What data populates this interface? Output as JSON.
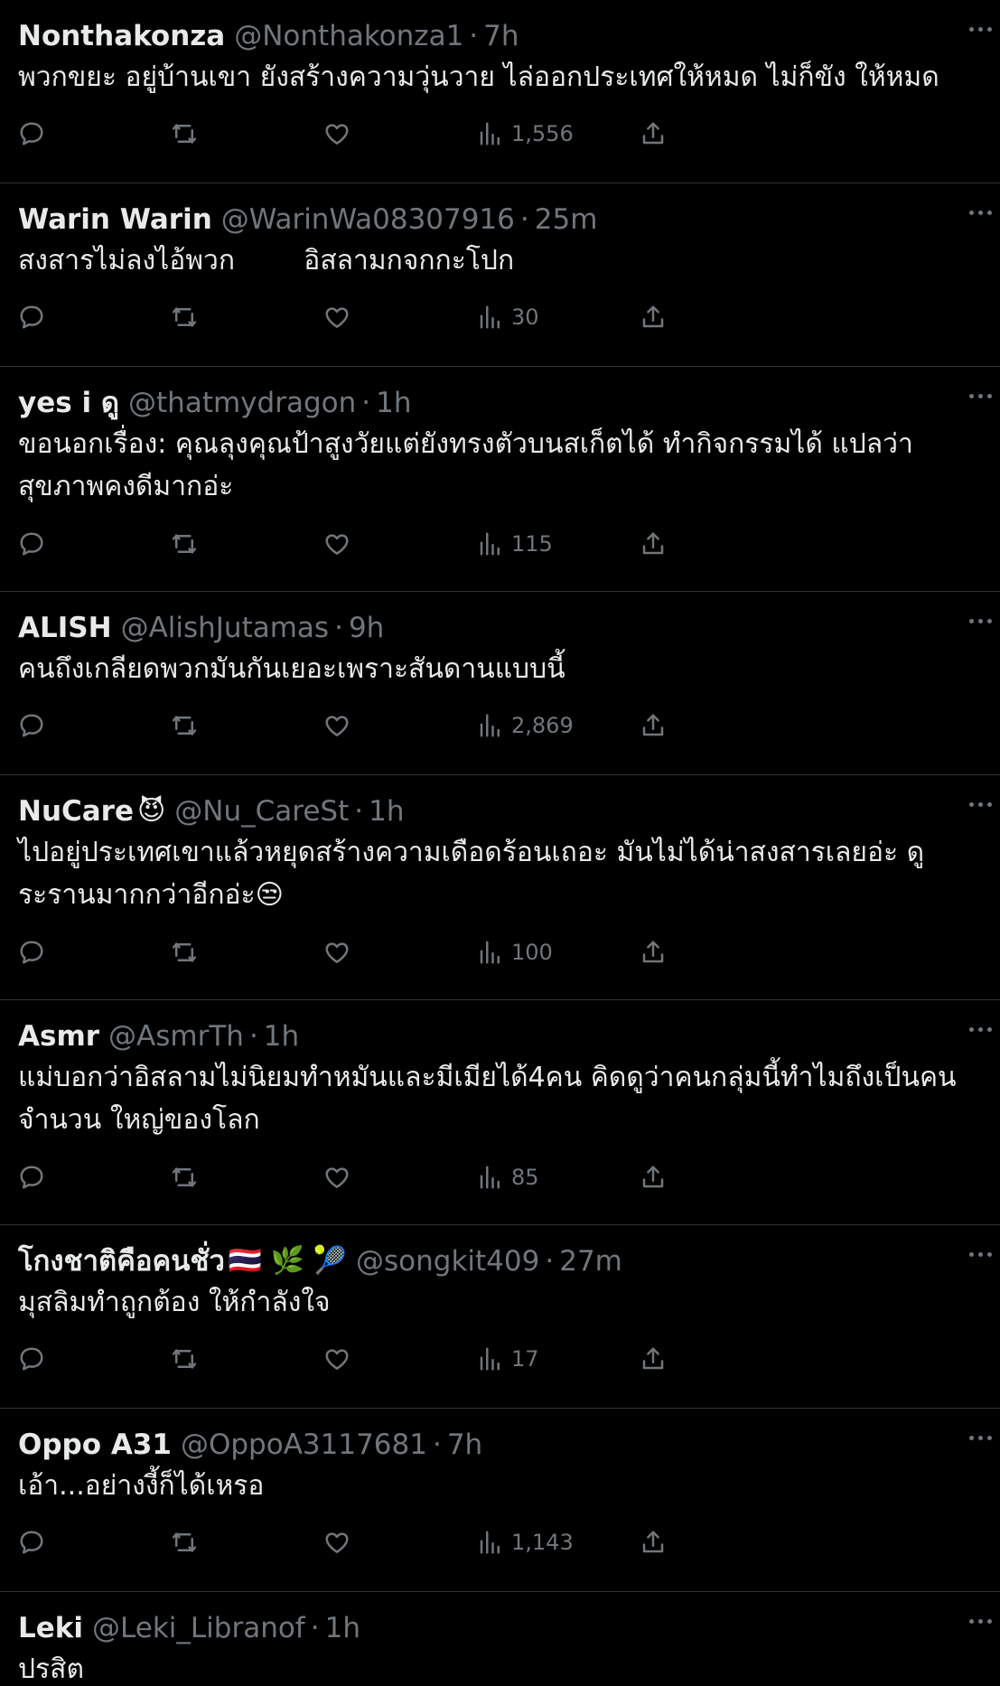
{
  "tweets": [
    {
      "name": "Nonthakonza",
      "emoji": "",
      "handle": "@Nonthakonza1",
      "time": "7h",
      "text": "พวกขยะ อยู่บ้านเขา ยังสร้างความวุ่นวาย ไล่ออกประเทศให้หมด ไม่ก็ขัง ให้หมด",
      "views": "1,556"
    },
    {
      "name": "Warin Warin",
      "emoji": "",
      "handle": "@WarinWa08307916",
      "time": "25m",
      "text": "สงสารไม่ลงไอ้พวก        อิสลามกจกกะโปก",
      "views": "30"
    },
    {
      "name": "yes i ดู",
      "emoji": "",
      "handle": "@thatmydragon",
      "time": "1h",
      "text": "ขอนอกเรื่อง: คุณลุงคุณป้าสูงวัยแต่ยังทรงตัวบนสเก็ตได้ ทำกิจกรรมได้ แปลว่าสุขภาพคงดีมากอ่ะ",
      "views": "115"
    },
    {
      "name": "ALISH",
      "emoji": "",
      "handle": "@AlishJutamas",
      "time": "9h",
      "text": "คนถึงเกลียดพวกมันกันเยอะเพราะสันดานแบบนี้",
      "views": "2,869"
    },
    {
      "name": "NuCare",
      "emoji": "😈",
      "handle": "@Nu_CareSt",
      "time": "1h",
      "text": "ไปอยู่ประเทศเขาแล้วหยุดสร้างความเดือดร้อนเถอะ มันไม่ได้น่าสงสารเลยอ่ะ ดูระรานมากกว่าอีกอ่ะ😒",
      "views": "100"
    },
    {
      "name": "Asmr",
      "emoji": "",
      "handle": "@AsmrTh",
      "time": "1h",
      "text": "แม่บอกว่าอิสลามไม่นิยมทำหมันและมีเมียได้4คน คิดดูว่าคนกลุ่มนี้ทำไมถึงเป็นคนจำนวน ใหญ่ของโลก",
      "views": "85"
    },
    {
      "name": "โกงชาติคือคนชั่ว",
      "emoji": "🇹🇭 🌿 🎾",
      "handle": "@songkit409",
      "time": "27m",
      "text": "มุสลิมทำถูกต้อง ให้กำลังใจ",
      "views": "17"
    },
    {
      "name": "Oppo A31",
      "emoji": "",
      "handle": "@OppoA3117681",
      "time": "7h",
      "text": "เอ้า...อย่างงี้ก็ได้เหรอ",
      "views": "1,143"
    },
    {
      "name": "Leki",
      "emoji": "",
      "handle": "@Leki_Libranof",
      "time": "1h",
      "text": "ปรสิต",
      "views": ""
    }
  ],
  "separator": "·",
  "icons": {
    "reply": "reply-icon",
    "retweet": "retweet-icon",
    "like": "like-icon",
    "views": "views-icon",
    "share": "share-icon",
    "more": "more-icon"
  },
  "colors": {
    "background": "#000000",
    "text": "#e7e9ea",
    "muted": "#71767b",
    "divider": "#2f3336"
  }
}
